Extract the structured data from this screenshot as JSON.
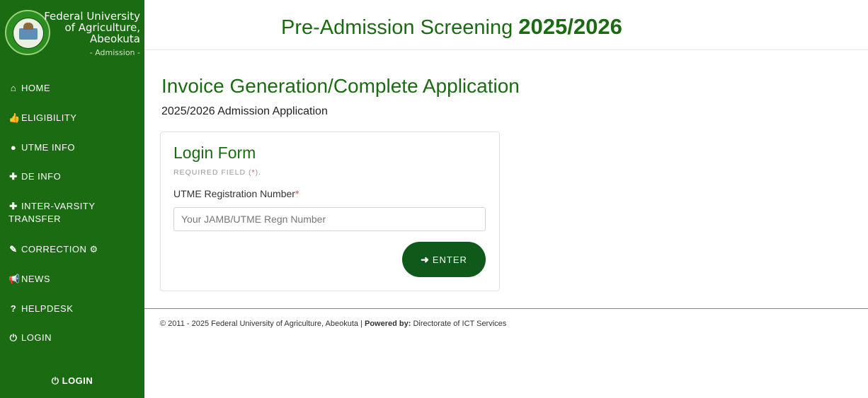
{
  "brand": {
    "name": "Federal University of Agriculture, Abeokuta",
    "subtitle": "- Admission -"
  },
  "sidebar": {
    "items": [
      {
        "label": "HOME",
        "icon": "home-icon",
        "glyph": "⌂"
      },
      {
        "label": "ELIGIBILITY",
        "icon": "thumbs-up-icon",
        "glyph": "👍"
      },
      {
        "label": "UTME INFO",
        "icon": "user-icon",
        "glyph": "●"
      },
      {
        "label": "DE INFO",
        "icon": "user-plus-icon",
        "glyph": "✚"
      },
      {
        "label": "INTER-VARSITY TRANSFER",
        "icon": "user-plus-icon",
        "glyph": "✚"
      },
      {
        "label": "CORRECTION",
        "icon": "eraser-icon",
        "glyph": "✎",
        "suffix_icon": "gear-icon",
        "suffix_glyph": "⚙"
      },
      {
        "label": "NEWS",
        "icon": "bullhorn-icon",
        "glyph": "📢"
      },
      {
        "label": "HELPDESK",
        "icon": "question-circle-icon",
        "glyph": "?"
      },
      {
        "label": "LOGIN",
        "icon": "power-icon",
        "glyph": "⏻"
      }
    ],
    "bottom_login": {
      "label": "LOGIN",
      "glyph": "⏻"
    }
  },
  "header": {
    "title": "Pre-Admission Screening",
    "year": "2025/2026"
  },
  "main": {
    "heading": "Invoice Generation/Complete Application",
    "subheading": "2025/2026 Admission Application"
  },
  "form": {
    "title": "Login Form",
    "required_note_prefix": "REQUIRED FIELD (",
    "required_star": "*",
    "required_note_suffix": ").",
    "field_label": "UTME Registration Number",
    "field_star": "*",
    "field_placeholder": "Your JAMB/UTME Regn Number",
    "field_value": "",
    "submit_label": "ENTER",
    "submit_glyph": "➜"
  },
  "footer": {
    "copyright": "© 2011 - 2025 Federal University of Agriculture, Abeokuta | ",
    "powered_label": "Powered by:",
    "powered_value": " Directorate of ICT Services"
  },
  "colors": {
    "sidebar": "#1a6b12",
    "accent": "#1a6b12",
    "button": "#0f5a1a",
    "required": "#d9534f"
  }
}
